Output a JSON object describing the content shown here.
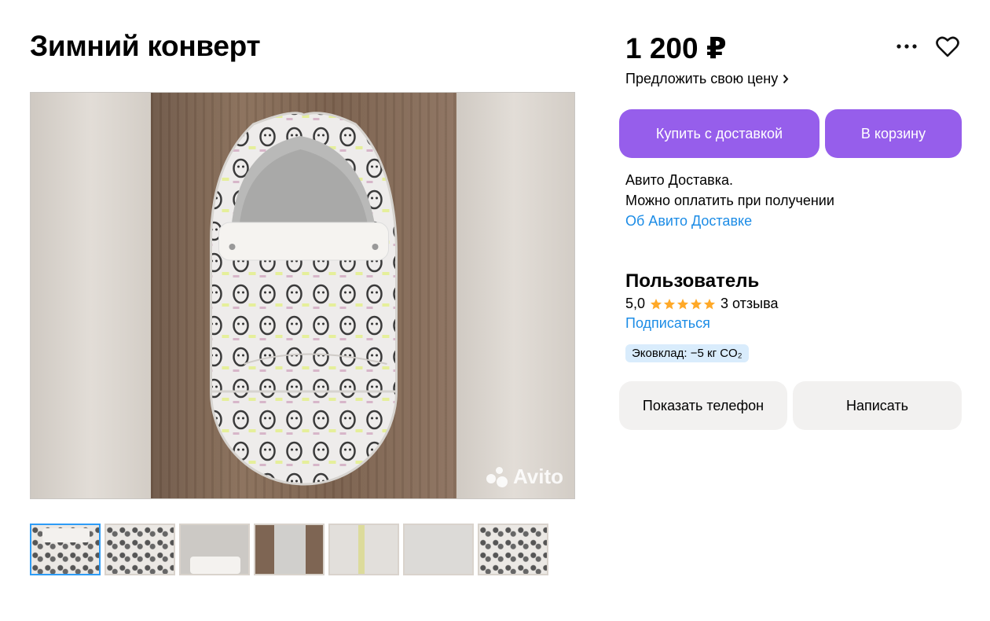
{
  "listing": {
    "title": "Зимний конверт",
    "price": "1 200 ₽",
    "offer_price_link": "Предложить свою цену",
    "watermark": "Avito",
    "thumbnail_count": 7
  },
  "actions": {
    "buy_with_delivery": "Купить с доставкой",
    "add_to_cart": "В корзину",
    "show_phone": "Показать телефон",
    "write_message": "Написать"
  },
  "delivery": {
    "line1": "Авито Доставка.",
    "line2": "Можно оплатить при получении",
    "about_link": "Об Авито Доставке"
  },
  "seller": {
    "name": "Пользователь",
    "rating": "5,0",
    "stars": 5,
    "reviews": "3 отзыва",
    "subscribe": "Подписаться",
    "eco_badge": "Эковклад: −5 кг CO₂"
  },
  "icons": {
    "more": "more-dots-icon",
    "favorite": "heart-icon",
    "chevron": "chevron-right-icon",
    "star": "star-icon"
  },
  "colors": {
    "accent_purple": "#965eeb",
    "link_blue": "#1c8ce6",
    "star_orange": "#ffa928",
    "active_thumb_border": "#2d9cf6",
    "eco_badge_bg": "#d9ecfc",
    "secondary_button_bg": "#f2f1f0"
  }
}
